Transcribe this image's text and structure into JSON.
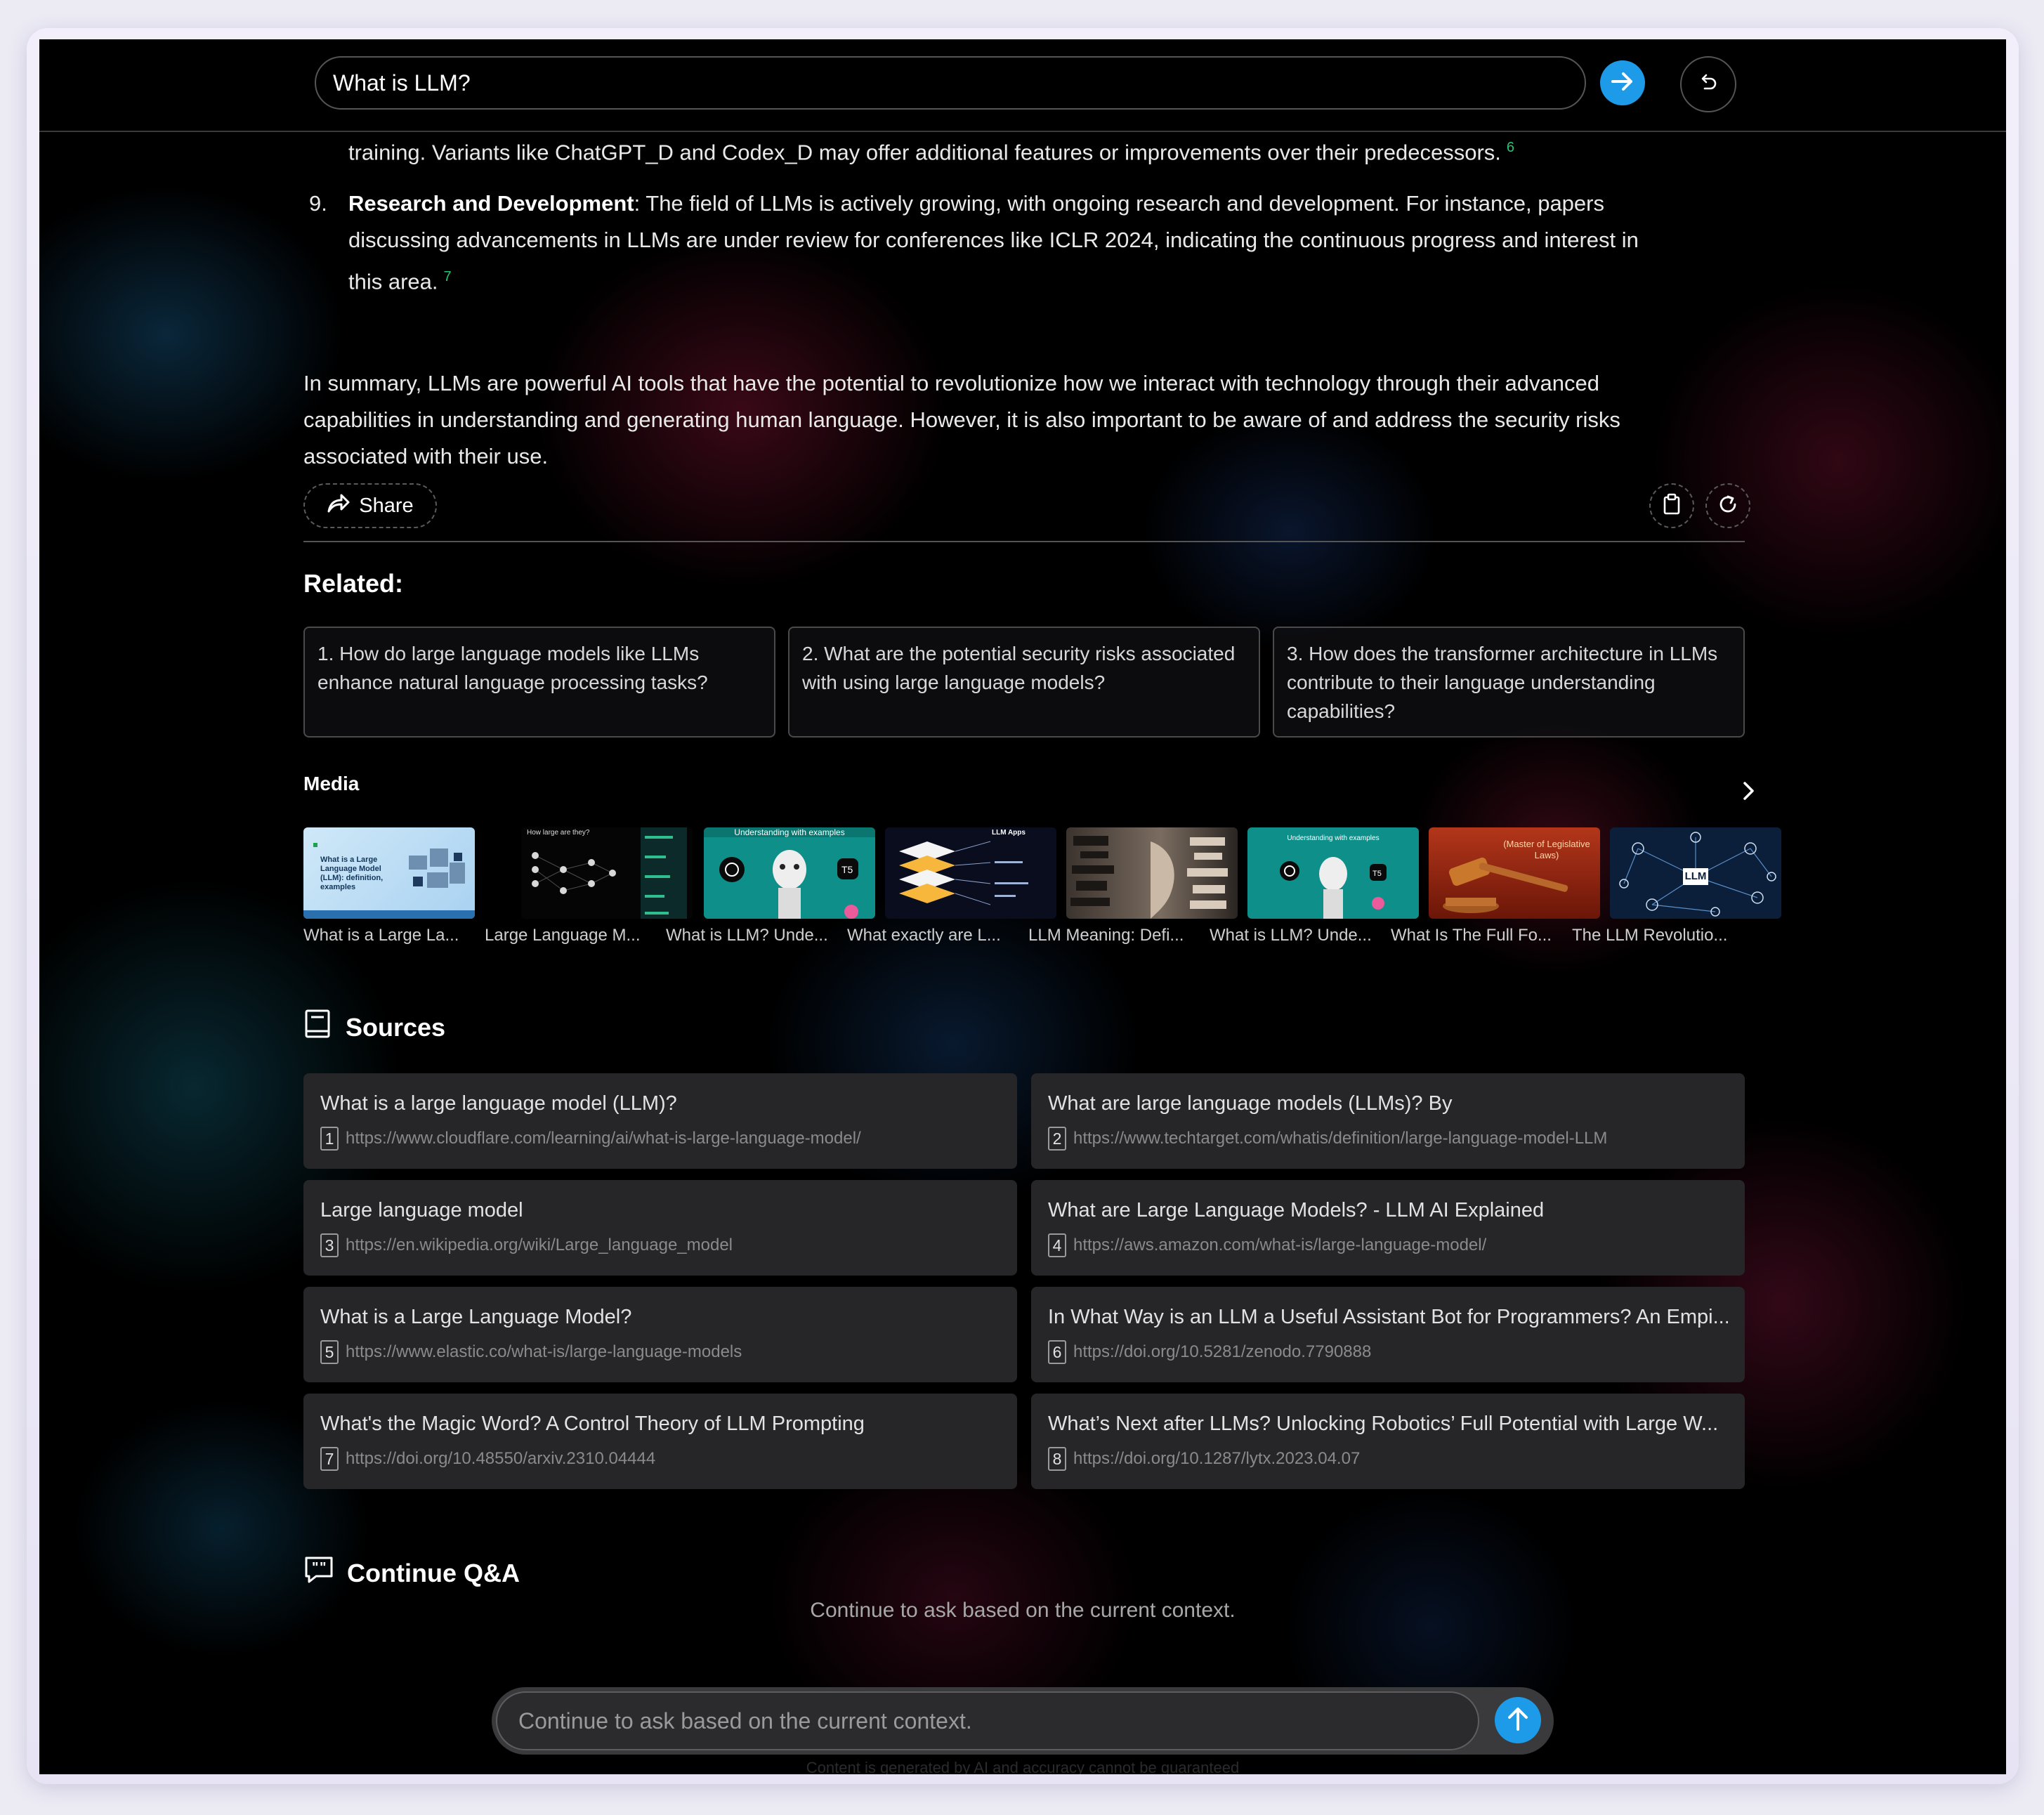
{
  "header": {
    "query": "What is LLM?",
    "submit_icon": "arrow-right-icon",
    "reset_icon": "undo-icon"
  },
  "answer": {
    "continuation": "training. Variants like ChatGPT_D and Codex_D may offer additional features or improvements over their predecessors.",
    "continuation_cite": "6",
    "item9_number": "9.",
    "item9_title": "Research and Development",
    "item9_line1": ": The field of LLMs is actively growing, with ongoing research and development. For instance, papers",
    "item9_line2": "discussing advancements in LLMs are under review for conferences like ICLR 2024, indicating the continuous progress and interest in",
    "item9_line3": "this area.",
    "item9_cite": "7",
    "summary_line1": "In summary, LLMs are powerful AI tools that have the potential to revolutionize how we interact with technology through their advanced",
    "summary_line2": "capabilities in understanding and generating human language. However, it is also important to be aware of and address the security risks",
    "summary_line3": "associated with their use."
  },
  "actions": {
    "share_label": "Share",
    "copy_icon": "clipboard-icon",
    "regenerate_icon": "refresh-icon"
  },
  "related": {
    "title": "Related:",
    "items": [
      {
        "label": "1. How do large language models like LLMs enhance natural language processing tasks?"
      },
      {
        "label": "2. What are the potential security risks associated with using large language models?"
      },
      {
        "label": "3. How does the transformer architecture in LLMs contribute to their language understanding capabilities?"
      }
    ]
  },
  "media": {
    "title": "Media",
    "next_icon": "chevron-right-icon",
    "items": [
      {
        "caption": "What is a Large La...",
        "thumb_text": "What is a Large Language Model (LLM): definition, examples"
      },
      {
        "caption": "Large Language M...",
        "thumb_text": "How large are they?"
      },
      {
        "caption": "What is LLM? Unde...",
        "thumb_text": "Understanding with examples"
      },
      {
        "caption": "What exactly are L...",
        "thumb_text": "LLM Apps"
      },
      {
        "caption": "LLM Meaning: Defi...",
        "thumb_text": ""
      },
      {
        "caption": "What is LLM? Unde...",
        "thumb_text": "Understanding with examples"
      },
      {
        "caption": "What Is The Full Fo...",
        "thumb_text": "(Master of Legislative Laws)"
      },
      {
        "caption": "The LLM Revolutio...",
        "thumb_text": "LLM"
      }
    ]
  },
  "sources": {
    "title": "Sources",
    "items": [
      {
        "num": "1",
        "title": "What is a large language model (LLM)?",
        "url": "https://www.cloudflare.com/learning/ai/what-is-large-language-model/"
      },
      {
        "num": "2",
        "title": "What are large language models (LLMs)? By",
        "url": "https://www.techtarget.com/whatis/definition/large-language-model-LLM"
      },
      {
        "num": "3",
        "title": "Large language model",
        "url": "https://en.wikipedia.org/wiki/Large_language_model"
      },
      {
        "num": "4",
        "title": "What are Large Language Models? - LLM AI Explained",
        "url": "https://aws.amazon.com/what-is/large-language-model/"
      },
      {
        "num": "5",
        "title": "What is a Large Language Model?",
        "url": "https://www.elastic.co/what-is/large-language-models"
      },
      {
        "num": "6",
        "title": "In What Way is an LLM a Useful Assistant Bot for Programmers? An Empi...",
        "url": "https://doi.org/10.5281/zenodo.7790888"
      },
      {
        "num": "7",
        "title": "What's the Magic Word? A Control Theory of LLM Prompting",
        "url": "https://doi.org/10.48550/arxiv.2310.04444"
      },
      {
        "num": "8",
        "title": "What’s Next after LLMs? Unlocking Robotics’ Full Potential with Large W...",
        "url": "https://doi.org/10.1287/lytx.2023.04.07"
      }
    ]
  },
  "continue_qa": {
    "title": "Continue Q&A",
    "hint": "Continue to ask based on the current context.",
    "placeholder": "Continue to ask based on the current context.",
    "send_icon": "arrow-up-icon",
    "disclaimer": "Content is generated by AI and accuracy cannot be guaranteed"
  },
  "colors": {
    "accent": "#1d9be9",
    "citation": "#28c46b",
    "background": "#000000",
    "card": "#262628"
  }
}
